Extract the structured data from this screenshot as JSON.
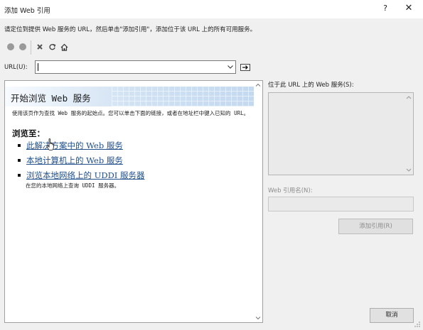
{
  "window": {
    "title": "添加 Web 引用",
    "help_glyph": "?",
    "close_glyph": "✕"
  },
  "instruction": "请定位到提供 Web 服务的 URL，然后单击\"添加引用\"，添加位于该 URL 上的所有可用服务。",
  "toolbar": {
    "icons": [
      "back-icon",
      "forward-icon",
      "stop-icon",
      "refresh-icon",
      "home-icon"
    ]
  },
  "url": {
    "label": "URL(U):",
    "value": "",
    "placeholder": ""
  },
  "browser": {
    "banner_title": "开始浏览 Web 服务",
    "intro": "使用该页作为查找 Web 服务的起始点。您可以单击下面的链接，或者在地址栏中键入已知的 URL。",
    "browse_heading": "浏览至：",
    "links": [
      {
        "label": "此解决方案中的 Web 服务"
      },
      {
        "label": "本地计算机上的 Web 服务"
      },
      {
        "label": "浏览本地网络上的 UDDI 服务器"
      }
    ],
    "uddi_description": "在您的本地网络上查询 UDDI 服务器。"
  },
  "services_panel": {
    "label": "位于此 URL 上的 Web 服务(S):"
  },
  "reference": {
    "label": "Web 引用名(N):",
    "value": "",
    "add_button": "添加引用(R)"
  },
  "cancel_button": "取消",
  "colors": {
    "link": "#1f4e8a",
    "dialog_bg": "#f0f0f0",
    "disabled_text": "#8c8c8c"
  }
}
